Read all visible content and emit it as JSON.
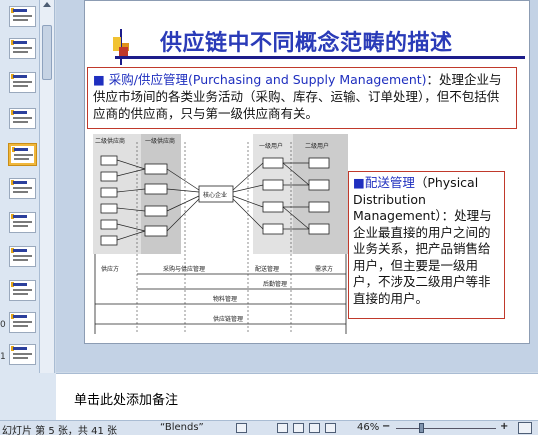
{
  "slide": {
    "title": "供应链中不同概念范畴的描述",
    "box1": {
      "bullet": "■",
      "term": "采购/供应管理(Purchasing and Supply Management)",
      "text": "：处理企业与供应市场间的各类业务活动（采购、库存、运输、订单处理），但不包括供应商的供应商，只与第一级供应商有关。"
    },
    "box2": {
      "bullet": "■",
      "term": "配送管理",
      "term_en": "（Physical Distribution Management）",
      "text": "：处理与企业最直接的用户之间的业务关系，把产品销售给用户，但主要是一级用户，不涉及二级用户等非直接的用户。"
    },
    "diagram": {
      "left_groups": [
        "二级供应商",
        "一级供应商"
      ],
      "center": "核心企业",
      "right_groups": [
        "一级用户",
        "二级用户"
      ],
      "bottom_labels": {
        "supplier": "供应方",
        "purchasing": "采购与供应管理",
        "distribution": "配送管理",
        "demand": "需求方",
        "logistics": "后勤管理",
        "materials": "物料管理",
        "supply_chain": "供应链管理"
      }
    }
  },
  "thumbnails": [
    {
      "num": "",
      "selected": false
    },
    {
      "num": "",
      "selected": false
    },
    {
      "num": "",
      "selected": false
    },
    {
      "num": "",
      "selected": false
    },
    {
      "num": "",
      "selected": true
    },
    {
      "num": "",
      "selected": false
    },
    {
      "num": "",
      "selected": false
    },
    {
      "num": "",
      "selected": false
    },
    {
      "num": "",
      "selected": false
    },
    {
      "num": "0",
      "selected": false
    },
    {
      "num": "1",
      "selected": false
    },
    {
      "num": "2",
      "selected": false
    },
    {
      "num": "3",
      "selected": false
    }
  ],
  "notes": {
    "placeholder": "单击此处添加备注"
  },
  "statusbar": {
    "slide_count": "幻灯片 第 5 张，共 41 张",
    "theme": "“Blends”",
    "zoom": "46%",
    "minus": "−",
    "plus": "+"
  },
  "colors": {
    "title": "#2a3bb8",
    "box_border": "#c0392b",
    "accent": "#f1c232"
  }
}
